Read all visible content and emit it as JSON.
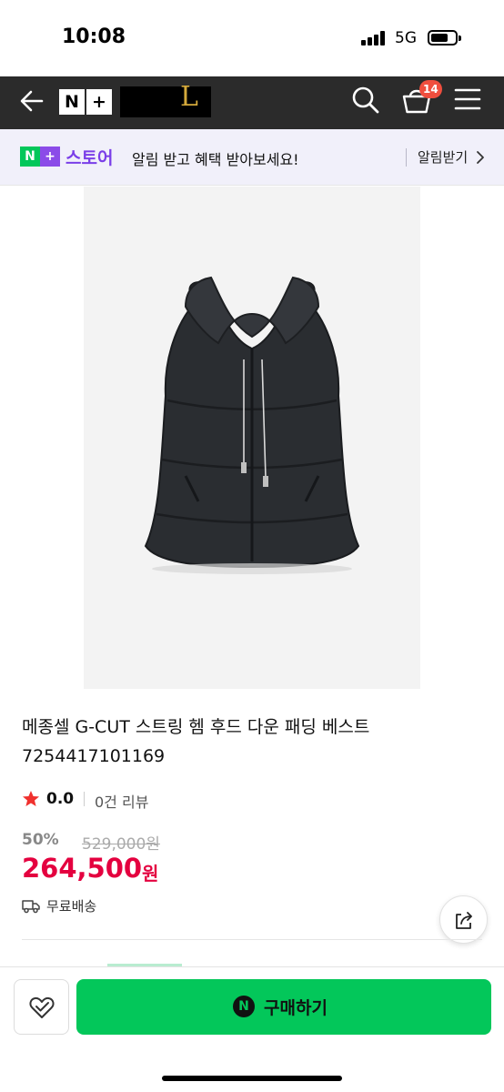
{
  "status_bar": {
    "time": "10:08",
    "network": "5G",
    "icons": [
      "signal-icon",
      "battery-icon"
    ]
  },
  "nav": {
    "logo_n": "N",
    "logo_plus": "+",
    "brand_letter": "L",
    "cart_count": "14",
    "icons": [
      "back-arrow-icon",
      "search-icon",
      "basket-icon",
      "hamburger-menu-icon"
    ]
  },
  "notice": {
    "badge_n": "N",
    "badge_plus": "+",
    "store_label": "스토어",
    "message": "알림 받고 혜택 받아보세요!",
    "action_label": "알림받기"
  },
  "product": {
    "title": "메종셀 G-CUT 스트링 헴 후드 다운 패딩 베스트",
    "code": "7254417101169",
    "rating": "0.0",
    "review_count": "0건 리뷰",
    "discount_rate": "50%",
    "original_price": "529,000원",
    "sale_price": "264,500",
    "sale_unit": "원",
    "shipping": "무료배송"
  },
  "actions": {
    "buy_label": "구매하기",
    "buy_icon_letter": "N"
  },
  "colors": {
    "naver_green": "#03c75a",
    "plus_purple": "#8b4be8",
    "sale_red": "#e4003f",
    "nav_bg": "#2b2b2b",
    "badge_red": "#f04e3e"
  }
}
